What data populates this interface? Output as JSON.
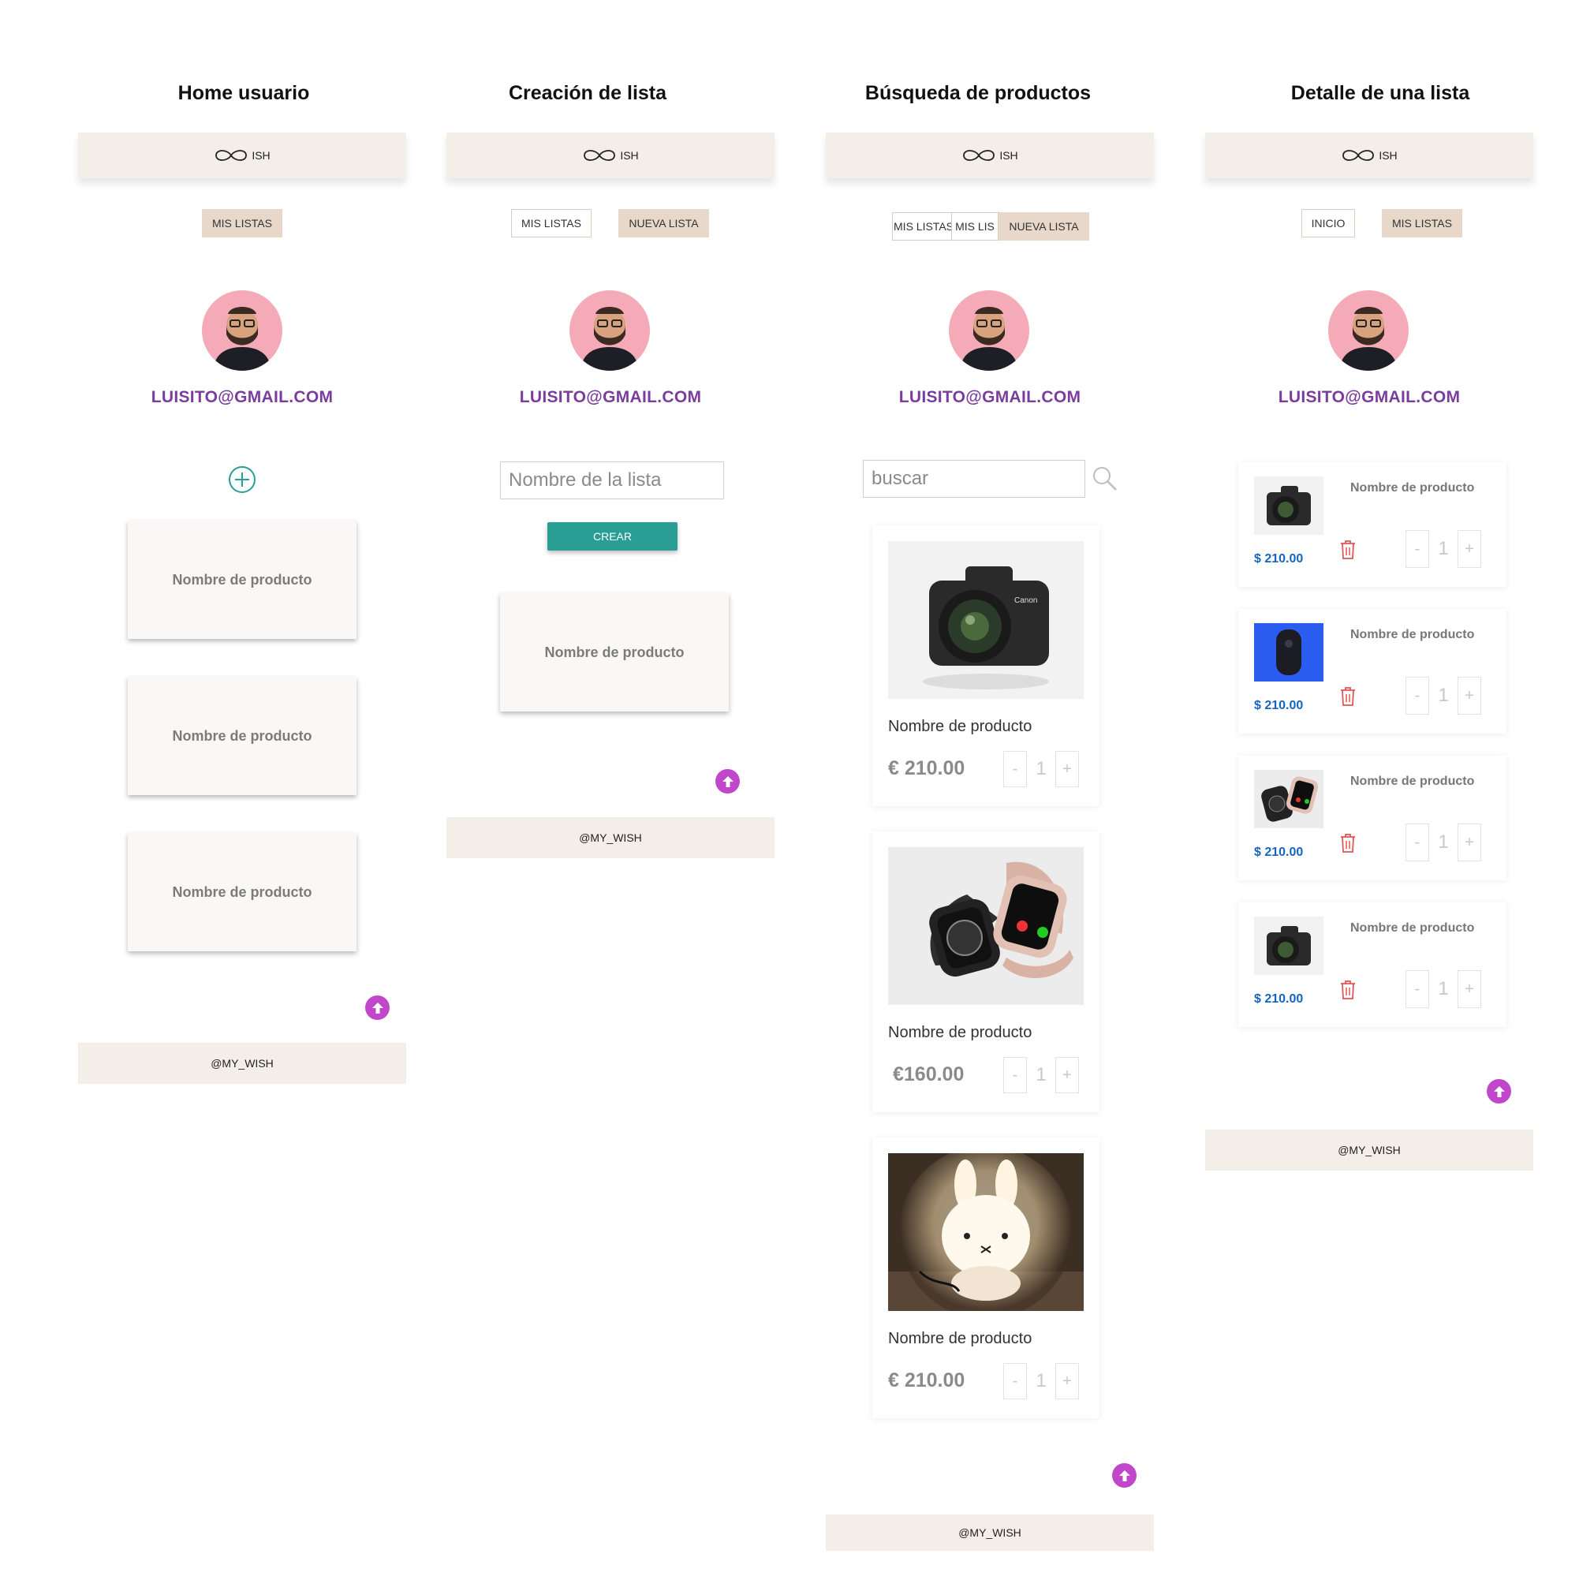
{
  "screens": [
    {
      "title": "Home usuario"
    },
    {
      "title": "Creación de lista"
    },
    {
      "title": "Búsqueda de productos"
    },
    {
      "title": "Detalle de una lista"
    }
  ],
  "brand": {
    "logo_text": "ISH"
  },
  "nav": {
    "mis_listas": "MIS LISTAS",
    "nueva_lista": "NUEVA LISTA",
    "inicio": "INICIO",
    "mis_lis_truncated": "MIS LIS"
  },
  "user": {
    "email": "LUISITO@GMAIL.COM"
  },
  "footer": {
    "text": "@MY_WISH"
  },
  "home": {
    "lists": [
      "Nombre de producto",
      "Nombre de producto",
      "Nombre de producto"
    ]
  },
  "create": {
    "name_placeholder": "Nombre de la lista",
    "crear_label": "CREAR",
    "list_card": "Nombre de producto"
  },
  "search": {
    "placeholder": "buscar",
    "products": [
      {
        "name": "Nombre de producto",
        "price": "€ 210.00",
        "qty": "1",
        "image": "camera"
      },
      {
        "name": "Nombre de producto",
        "price": "€160.00",
        "qty": "1",
        "image": "smartwatch"
      },
      {
        "name": "Nombre de producto",
        "price": "€ 210.00",
        "qty": "1",
        "image": "bunny-lamp"
      }
    ]
  },
  "detail": {
    "items": [
      {
        "name": "Nombre de producto",
        "price": "$ 210.00",
        "qty": "1",
        "image": "camera"
      },
      {
        "name": "Nombre de producto",
        "price": "$ 210.00",
        "qty": "1",
        "image": "tracker-blue"
      },
      {
        "name": "Nombre de producto",
        "price": "$ 210.00",
        "qty": "1",
        "image": "smartwatch"
      },
      {
        "name": "Nombre de producto",
        "price": "$ 210.00",
        "qty": "1",
        "image": "camera"
      }
    ]
  },
  "qty_buttons": {
    "minus": "-",
    "plus": "+"
  },
  "colors": {
    "header_bg": "#f4eee9",
    "nav_filled": "#e7d8ca",
    "email": "#7a3d9e",
    "accent_teal": "#2a9d94",
    "scroll_top": "#c046cc",
    "detail_price": "#1565c0",
    "trash": "#e05555"
  }
}
